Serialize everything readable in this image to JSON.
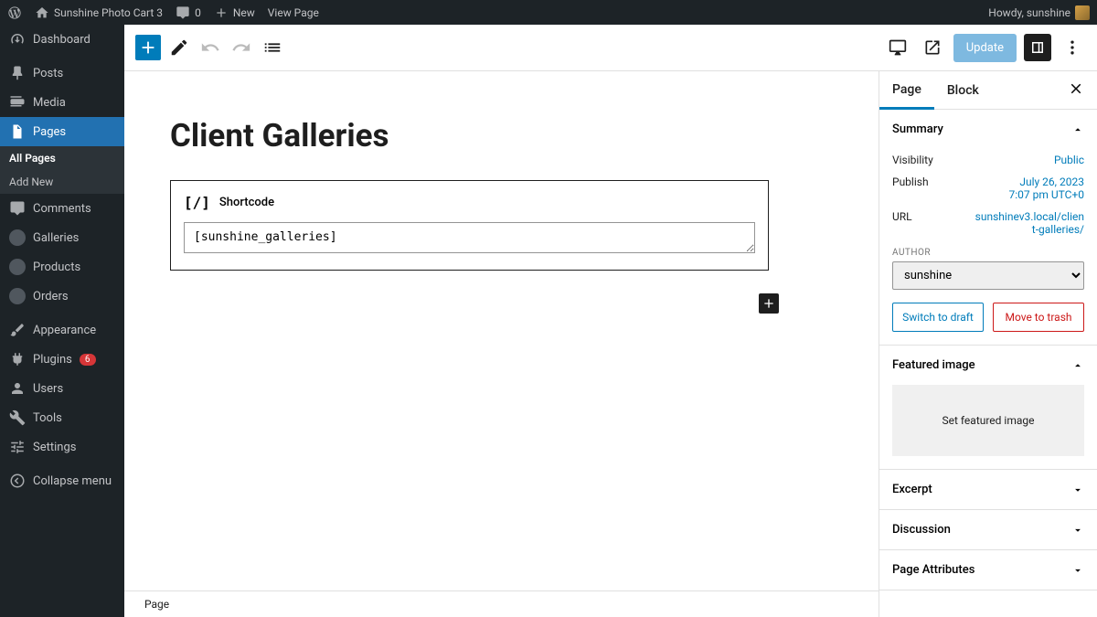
{
  "adminbar": {
    "site_name": "Sunshine Photo Cart 3",
    "comments_count": "0",
    "new_label": "New",
    "view_page_label": "View Page",
    "howdy": "Howdy, sunshine"
  },
  "sidebar": {
    "dashboard": "Dashboard",
    "posts": "Posts",
    "media": "Media",
    "pages": "Pages",
    "all_pages": "All Pages",
    "add_new": "Add New",
    "comments": "Comments",
    "galleries": "Galleries",
    "products": "Products",
    "orders": "Orders",
    "appearance": "Appearance",
    "plugins": "Plugins",
    "plugins_count": "6",
    "users": "Users",
    "tools": "Tools",
    "settings": "Settings",
    "collapse": "Collapse menu"
  },
  "editor": {
    "update_label": "Update",
    "page_title": "Client Galleries",
    "shortcode_label": "Shortcode",
    "shortcode_value": "[sunshine_galleries]",
    "footer_breadcrumb": "Page"
  },
  "panel": {
    "tab_page": "Page",
    "tab_block": "Block",
    "summary": {
      "title": "Summary",
      "visibility_label": "Visibility",
      "visibility_value": "Public",
      "publish_label": "Publish",
      "publish_date": "July 26, 2023",
      "publish_time": "7:07 pm UTC+0",
      "url_label": "URL",
      "url_value": "sunshinev3.local/client-galleries/",
      "author_label": "AUTHOR",
      "author_value": "sunshine",
      "switch_draft": "Switch to draft",
      "move_trash": "Move to trash"
    },
    "featured_image": {
      "title": "Featured image",
      "button": "Set featured image"
    },
    "excerpt": "Excerpt",
    "discussion": "Discussion",
    "page_attributes": "Page Attributes"
  }
}
